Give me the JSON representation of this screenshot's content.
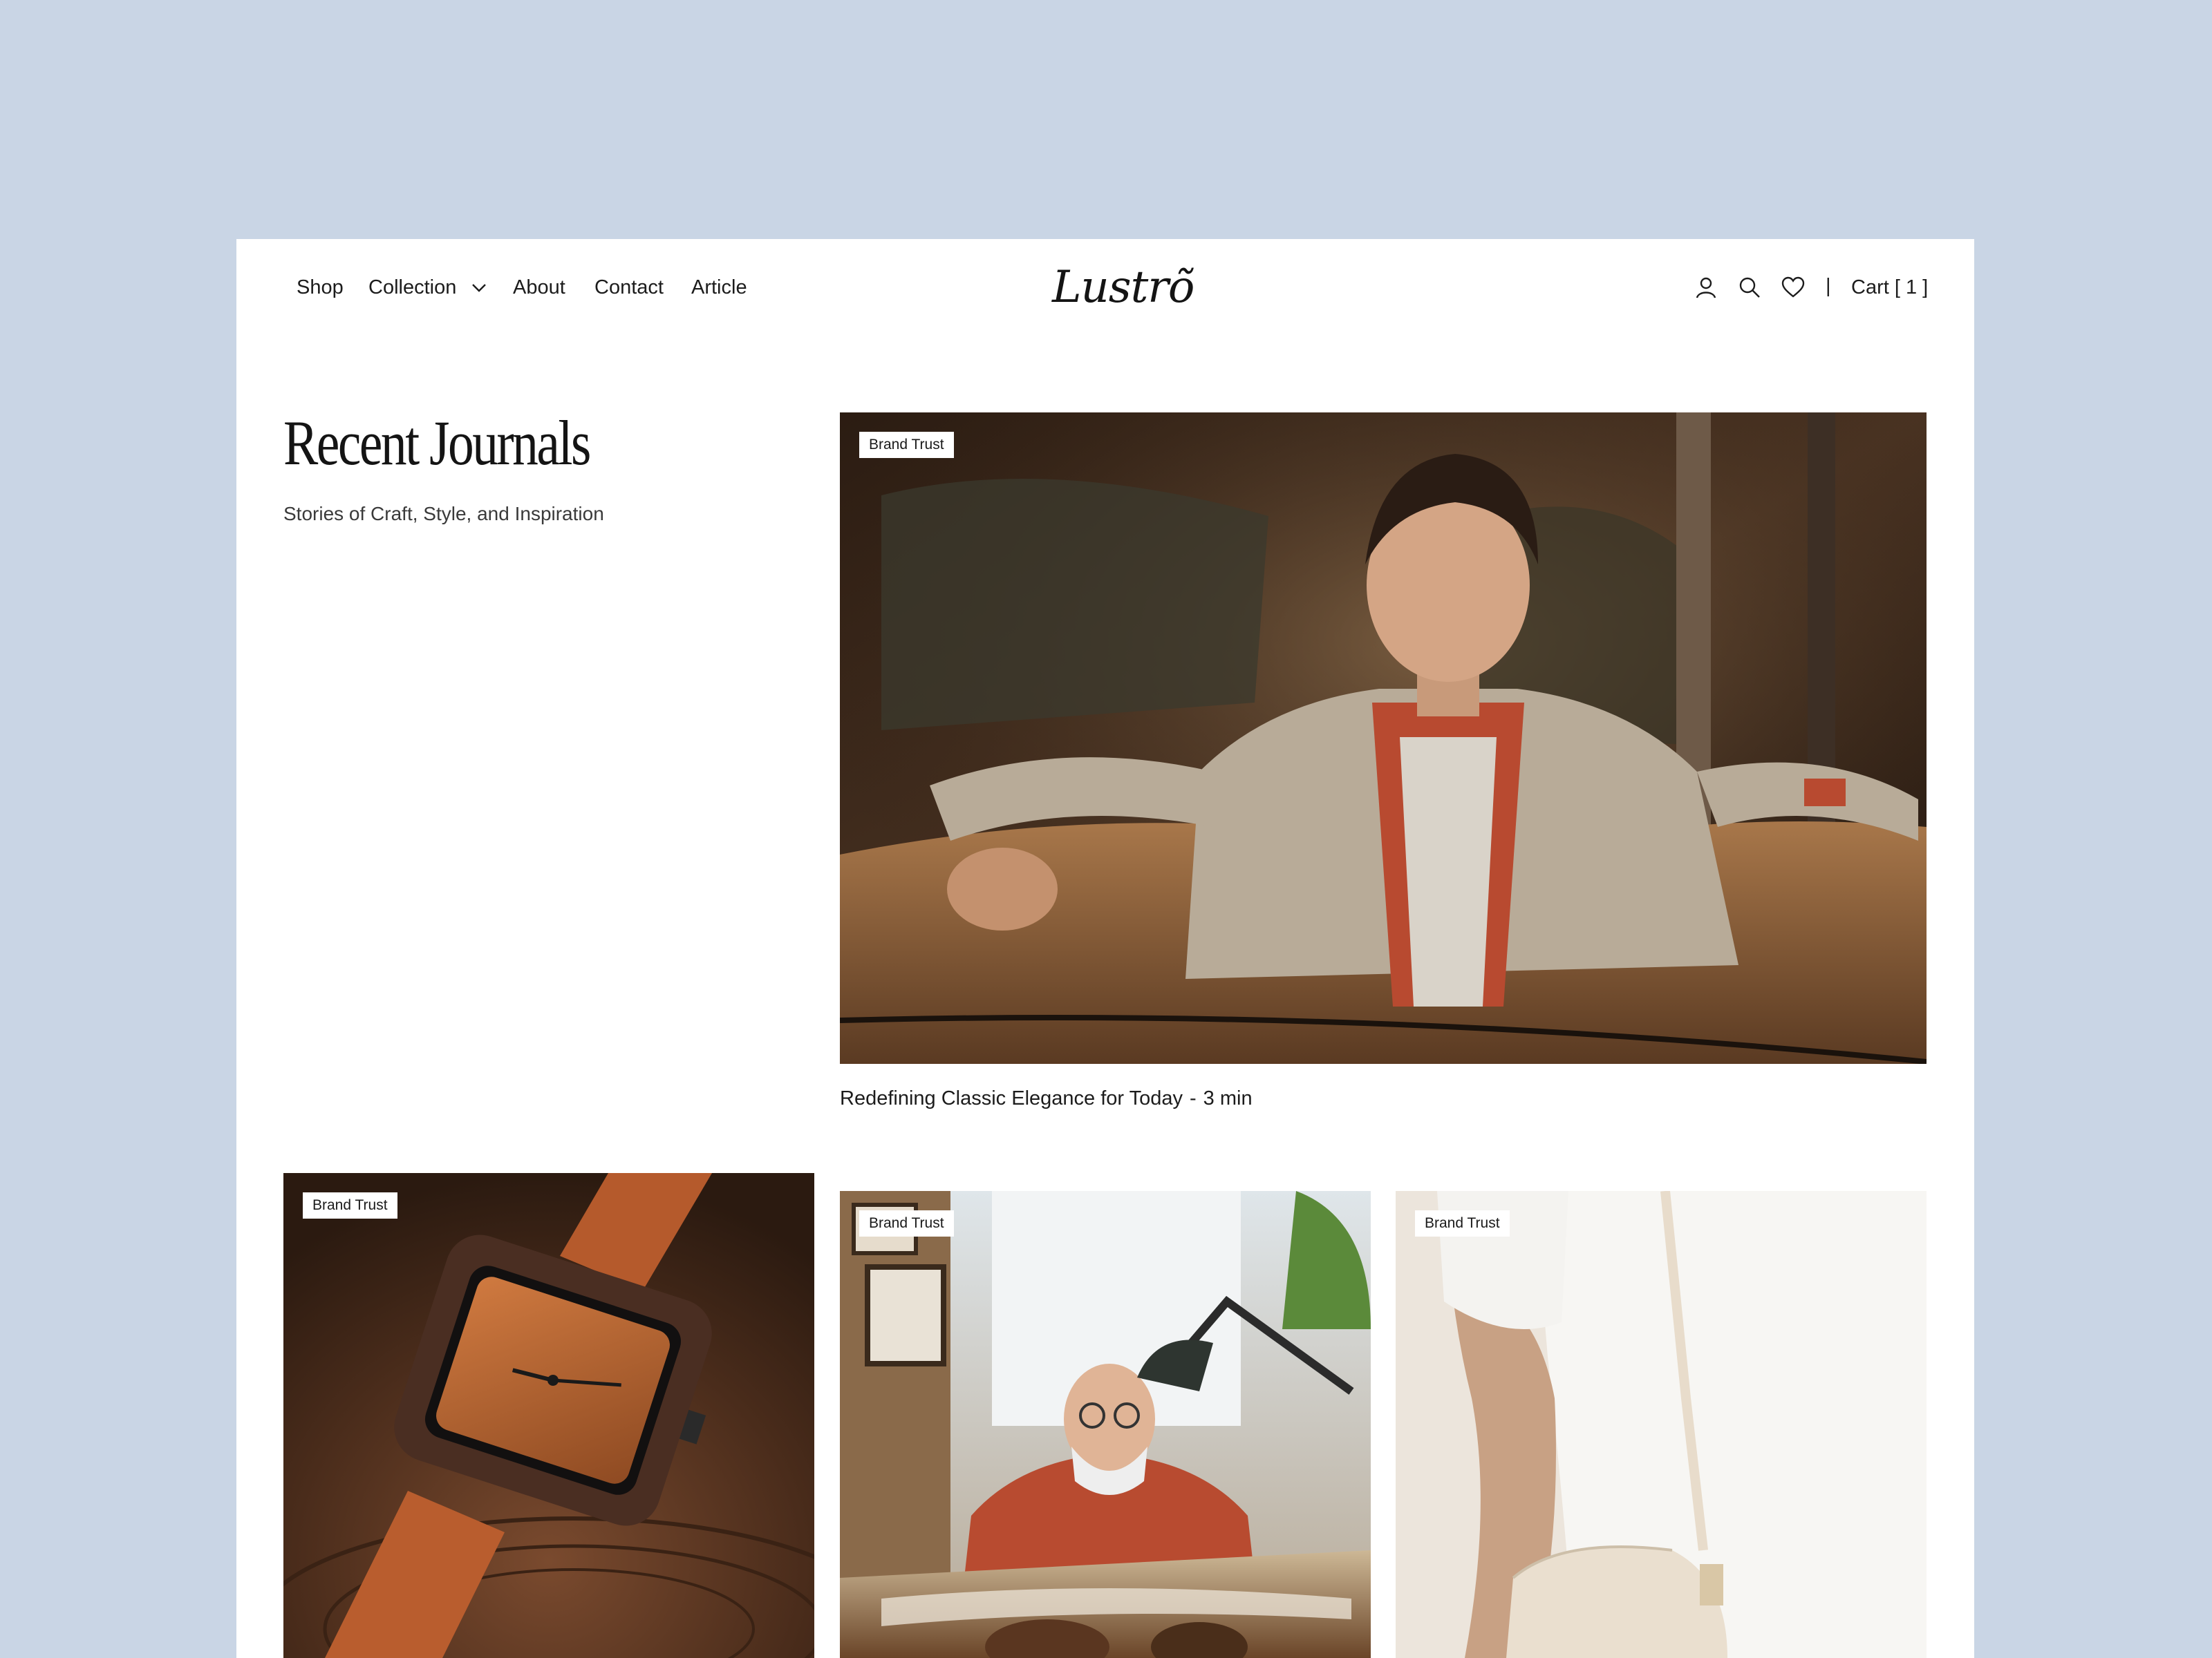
{
  "nav": {
    "shop": "Shop",
    "collection": "Collection",
    "about": "About",
    "contact": "Contact",
    "article": "Article"
  },
  "brand": {
    "logo": "Lustrõ"
  },
  "header_actions": {
    "icons": [
      "user-icon",
      "search-icon",
      "heart-icon"
    ],
    "divider": "|",
    "cart_label": "Cart [ 1 ]"
  },
  "section": {
    "title": "Recent Journals",
    "subtitle": "Stories of Craft, Style, and Inspiration"
  },
  "featured": {
    "tag": "Brand Trust",
    "title": "Redefining Classic Elegance for Today",
    "separator": "-",
    "read_time": "3 min"
  },
  "cards": [
    {
      "tag": "Brand Trust",
      "image": "wooden watch on tree stump"
    },
    {
      "tag": "Brand Trust",
      "image": "older craftsman at drafting desk"
    },
    {
      "tag": "Brand Trust",
      "image": "person in white tee with cream shoulder bag"
    }
  ],
  "colors": {
    "backdrop": "#c9d5e5",
    "page": "#ffffff",
    "text": "#1c1c1c"
  }
}
